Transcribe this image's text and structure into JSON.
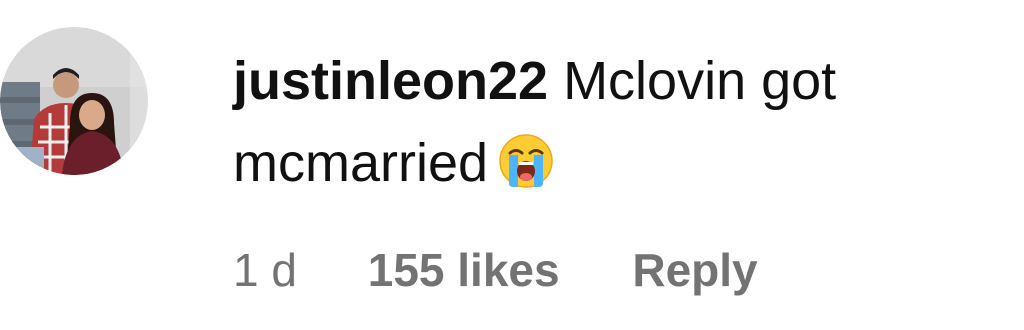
{
  "comment": {
    "username": "justinleon22",
    "text": "Mclovin got mcmarried",
    "emoji": "loudly-crying-face-emoji",
    "time": "1 d",
    "likes": "155 likes",
    "reply_label": "Reply"
  },
  "avatar": {
    "icon": "profile-photo-couple"
  },
  "colors": {
    "text": "#111111",
    "meta": "#737373",
    "background": "#ffffff"
  }
}
